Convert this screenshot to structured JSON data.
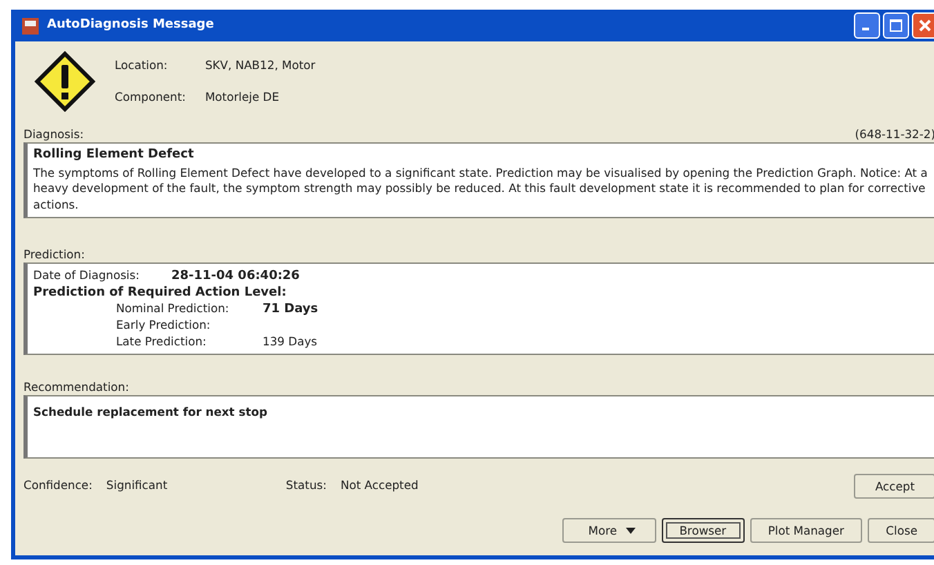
{
  "window": {
    "title": "AutoDiagnosis Message"
  },
  "header": {
    "fields": [
      {
        "label": "Location:",
        "value": "SKV, NAB12, Motor"
      },
      {
        "label": "Component:",
        "value": "Motorleje DE"
      }
    ]
  },
  "diagnosis": {
    "label": "Diagnosis:",
    "reference": "(648-11-32-2)",
    "title": "Rolling Element Defect",
    "text": "The symptoms of Rolling Element Defect have developed to a significant state. Prediction may be visualised by opening the Prediction Graph. Notice: At a heavy development of the fault, the symptom strength may possibly be reduced. At this fault development state it is recommended to plan for corrective actions."
  },
  "prediction": {
    "label": "Prediction:",
    "date_label": "Date of Diagnosis:",
    "date": "28-11-04 06:40:26",
    "heading": "Prediction of Required Action Level:",
    "rows": [
      {
        "label": "Nominal Prediction:",
        "value": "71 Days",
        "emphasized": true
      },
      {
        "label": "Early Prediction:"
      },
      {
        "label": "Late Prediction:",
        "value": "139 Days",
        "emphasized": false
      }
    ]
  },
  "recommendation": {
    "label": "Recommendation:",
    "text": "Schedule replacement for next stop"
  },
  "footer": {
    "fields": [
      {
        "label": "Confidence:",
        "value": "Significant"
      },
      {
        "label": "Status:",
        "value": "Not Accepted"
      }
    ],
    "accept_button": "Accept"
  },
  "buttons": [
    {
      "label": "More",
      "kind": "dropdown",
      "focused": false
    },
    {
      "label": "Browser",
      "kind": "plain",
      "focused": true
    },
    {
      "label": "Plot Manager",
      "kind": "plain",
      "focused": false
    },
    {
      "label": "Close",
      "kind": "plain",
      "focused": false
    }
  ]
}
